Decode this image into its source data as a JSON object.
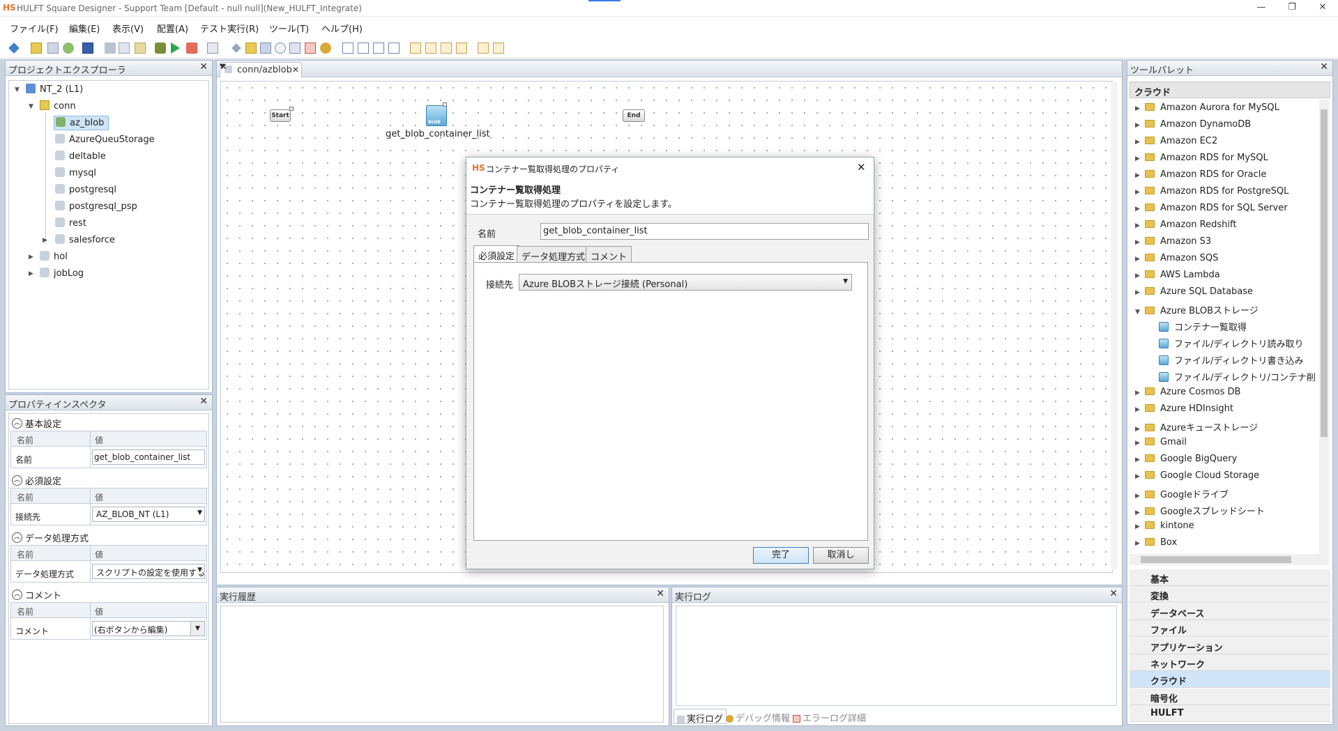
{
  "window": {
    "logo": "HS",
    "title": "HULFT Square Designer - Support Team [Default - null null](New_HULFT_Integrate)",
    "minimize": "—",
    "restore": "❐",
    "close": "✕"
  },
  "menu": [
    "ファイル(F)",
    "編集(E)",
    "表示(V)",
    "配置(A)",
    "テスト実行(R)",
    "ツール(T)",
    "ヘルプ(H)"
  ],
  "explorer": {
    "title": "プロジェクトエクスプローラ",
    "close": "✕",
    "root": "NT_2 (L1)",
    "conn": "conn",
    "children": [
      "az_blob",
      "AzureQueuStorage",
      "deltable",
      "mysql",
      "postgresql",
      "postgresql_psp",
      "rest",
      "salesforce"
    ],
    "others": [
      "hol",
      "jobLog"
    ]
  },
  "inspector": {
    "title": "プロパティインスペクタ",
    "close": "✕",
    "col_name": "名前",
    "col_value": "値",
    "sections": [
      {
        "title": "基本設定",
        "key": "名前",
        "value": "get_blob_container_list"
      },
      {
        "title": "必須設定",
        "key": "接続先",
        "value": "AZ_BLOB_NT (L1)"
      },
      {
        "title": "データ処理方式",
        "key": "データ処理方式",
        "value": "スクリプトの設定を使用する"
      },
      {
        "title": "コメント",
        "key": "コメント",
        "value": "(右ボタンから編集)"
      }
    ]
  },
  "editor": {
    "tab": "conn/azblob",
    "tab_close": "✕",
    "start": "Start",
    "end": "End",
    "blob_label": "BLOB",
    "component": "get_blob_container_list"
  },
  "dialog": {
    "logo": "HS",
    "title": "コンテナー覧取得処理のプロパティ",
    "close": "✕",
    "heading": "コンテナー覧取得処理",
    "description": "コンテナー覧取得処理のプロパティを設定します。",
    "name_label": "名前",
    "name_value": "get_blob_container_list",
    "tabs": [
      "必須設定",
      "データ処理方式",
      "コメント"
    ],
    "conn_label": "接続先",
    "conn_value": "Azure BLOBストレージ接続 (Personal)",
    "ok": "完了",
    "cancel": "取消し"
  },
  "history": {
    "title": "実行履歴",
    "close": "✕"
  },
  "log": {
    "title": "実行ログ",
    "close": "✕",
    "tabs": [
      "実行ログ",
      "デバッグ情報",
      "エラーログ詳細"
    ]
  },
  "palette": {
    "title": "ツールパレット",
    "close": "✕",
    "header": "クラウド",
    "items": [
      {
        "label": "Amazon Aurora for MySQL",
        "type": "folder",
        "expanded": false
      },
      {
        "label": "Amazon DynamoDB",
        "type": "folder",
        "expanded": false
      },
      {
        "label": "Amazon EC2",
        "type": "folder",
        "expanded": false
      },
      {
        "label": "Amazon RDS for MySQL",
        "type": "folder",
        "expanded": false
      },
      {
        "label": "Amazon RDS for Oracle",
        "type": "folder",
        "expanded": false
      },
      {
        "label": "Amazon RDS for PostgreSQL",
        "type": "folder",
        "expanded": false
      },
      {
        "label": "Amazon RDS for SQL Server",
        "type": "folder",
        "expanded": false
      },
      {
        "label": "Amazon Redshift",
        "type": "folder",
        "expanded": false
      },
      {
        "label": "Amazon S3",
        "type": "folder",
        "expanded": false
      },
      {
        "label": "Amazon SQS",
        "type": "folder",
        "expanded": false
      },
      {
        "label": "AWS Lambda",
        "type": "folder",
        "expanded": false
      },
      {
        "label": "Azure SQL Database",
        "type": "folder",
        "expanded": false
      },
      {
        "label": "Azure BLOBストレージ",
        "type": "folder",
        "expanded": true
      },
      {
        "label": "コンテナ一覧取得",
        "type": "component"
      },
      {
        "label": "ファイル/ディレクトリ読み取り",
        "type": "component"
      },
      {
        "label": "ファイル/ディレクトリ書き込み",
        "type": "component"
      },
      {
        "label": "ファイル/ディレクトリ/コンテナ削",
        "type": "component"
      },
      {
        "label": "Azure Cosmos DB",
        "type": "folder",
        "expanded": false
      },
      {
        "label": "Azure HDInsight",
        "type": "folder",
        "expanded": false
      },
      {
        "label": "Azureキューストレージ",
        "type": "folder",
        "expanded": false
      },
      {
        "label": "Gmail",
        "type": "folder",
        "expanded": false
      },
      {
        "label": "Google BigQuery",
        "type": "folder",
        "expanded": false
      },
      {
        "label": "Google Cloud Storage",
        "type": "folder",
        "expanded": false
      },
      {
        "label": "Googleドライブ",
        "type": "folder",
        "expanded": false
      },
      {
        "label": "Googleスプレッドシート",
        "type": "folder",
        "expanded": false
      },
      {
        "label": "kintone",
        "type": "folder",
        "expanded": false
      },
      {
        "label": "Box",
        "type": "folder",
        "expanded": false
      }
    ],
    "categories": [
      "基本",
      "変換",
      "データベース",
      "ファイル",
      "アプリケーション",
      "ネットワーク",
      "クラウド",
      "暗号化",
      "HULFT"
    ],
    "selected_category": "クラウド"
  },
  "colors": {
    "accent": "#3b78e7",
    "logo": "#e8742a",
    "selection": "#cfe5f7"
  }
}
